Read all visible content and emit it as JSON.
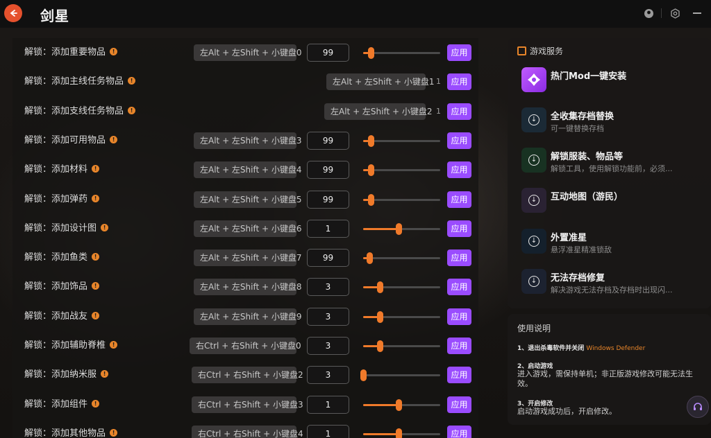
{
  "app": {
    "title": "剑星"
  },
  "rows": [
    {
      "label": "解锁：添加重要物品",
      "hotkey": "左Alt + 左Shift + 小键盘0",
      "value": "99",
      "slider": 0.1,
      "apply": "应用"
    },
    {
      "label": "解锁：添加主线任务物品",
      "hotkey": "左Alt + 左Shift + 小键盘1",
      "value": "1",
      "apply": "应用"
    },
    {
      "label": "解锁：添加支线任务物品",
      "hotkey": "左Alt + 左Shift + 小键盘2",
      "value": "1",
      "apply": "应用"
    },
    {
      "label": "解锁：添加可用物品",
      "hotkey": "左Alt + 左Shift + 小键盘3",
      "value": "99",
      "slider": 0.1,
      "apply": "应用"
    },
    {
      "label": "解锁：添加材料",
      "hotkey": "左Alt + 左Shift + 小键盘4",
      "value": "99",
      "slider": 0.1,
      "apply": "应用"
    },
    {
      "label": "解锁：添加弹药",
      "hotkey": "左Alt + 左Shift + 小键盘5",
      "value": "99",
      "slider": 0.1,
      "apply": "应用"
    },
    {
      "label": "解锁：添加设计图",
      "hotkey": "左Alt + 左Shift + 小键盘6",
      "value": "1",
      "slider": 0.46,
      "apply": "应用"
    },
    {
      "label": "解锁：添加鱼类",
      "hotkey": "左Alt + 左Shift + 小键盘7",
      "value": "99",
      "slider": 0.08,
      "apply": "应用"
    },
    {
      "label": "解锁：添加饰品",
      "hotkey": "左Alt + 左Shift + 小键盘8",
      "value": "3",
      "slider": 0.22,
      "apply": "应用"
    },
    {
      "label": "解锁：添加战友",
      "hotkey": "左Alt + 左Shift + 小键盘9",
      "value": "3",
      "slider": 0.22,
      "apply": "应用"
    },
    {
      "label": "解锁：添加辅助脊椎",
      "hotkey": "右Ctrl + 右Shift + 小键盘0",
      "value": "3",
      "slider": 0.22,
      "apply": "应用"
    },
    {
      "label": "解锁：添加纳米服",
      "hotkey": "右Ctrl + 右Shift + 小键盘2",
      "value": "3",
      "slider": 0.0,
      "apply": "应用"
    },
    {
      "label": "解锁：添加组件",
      "hotkey": "右Ctrl + 右Shift + 小键盘3",
      "value": "1",
      "slider": 0.46,
      "apply": "应用"
    },
    {
      "label": "解锁：添加其他物品",
      "hotkey": "右Ctrl + 右Shift + 小键盘4",
      "value": "1",
      "slider": 0.46,
      "apply": "应用"
    }
  ],
  "services": {
    "title": "游戏服务",
    "items": [
      {
        "title": "热门Mod一键安装",
        "subtitle": "",
        "icon": "mod-icon"
      },
      {
        "title": "全收集存档替换",
        "subtitle": "可一键替换存档",
        "icon": "download-icon"
      },
      {
        "title": "解锁服装、物品等",
        "subtitle": "解锁工具，使用解锁功能前，必须...",
        "icon": "download-icon"
      },
      {
        "title": "互动地图（游民）",
        "subtitle": "",
        "icon": "download-icon"
      },
      {
        "title": "外置准星",
        "subtitle": "悬浮准星精准锁敌",
        "icon": "download-icon"
      },
      {
        "title": "无法存档修复",
        "subtitle": "解决游戏无法存档及存档时出现闪...",
        "icon": "download-icon"
      }
    ]
  },
  "instructions": {
    "title": "使用说明",
    "step1_title": "1、退出杀毒软件并关闭",
    "step1_accent": "Windows Defender",
    "step2_title": "2、启动游戏",
    "step2_text": "进入游戏，需保持单机；非正版游戏修改可能无法生效。",
    "step3_title": "3、开启修改",
    "step3_text": "启动游戏成功后，开启修改。"
  },
  "colors": {
    "accent": "#e8852a",
    "apply": "#9a4cff",
    "slider": "#f07a2a"
  }
}
